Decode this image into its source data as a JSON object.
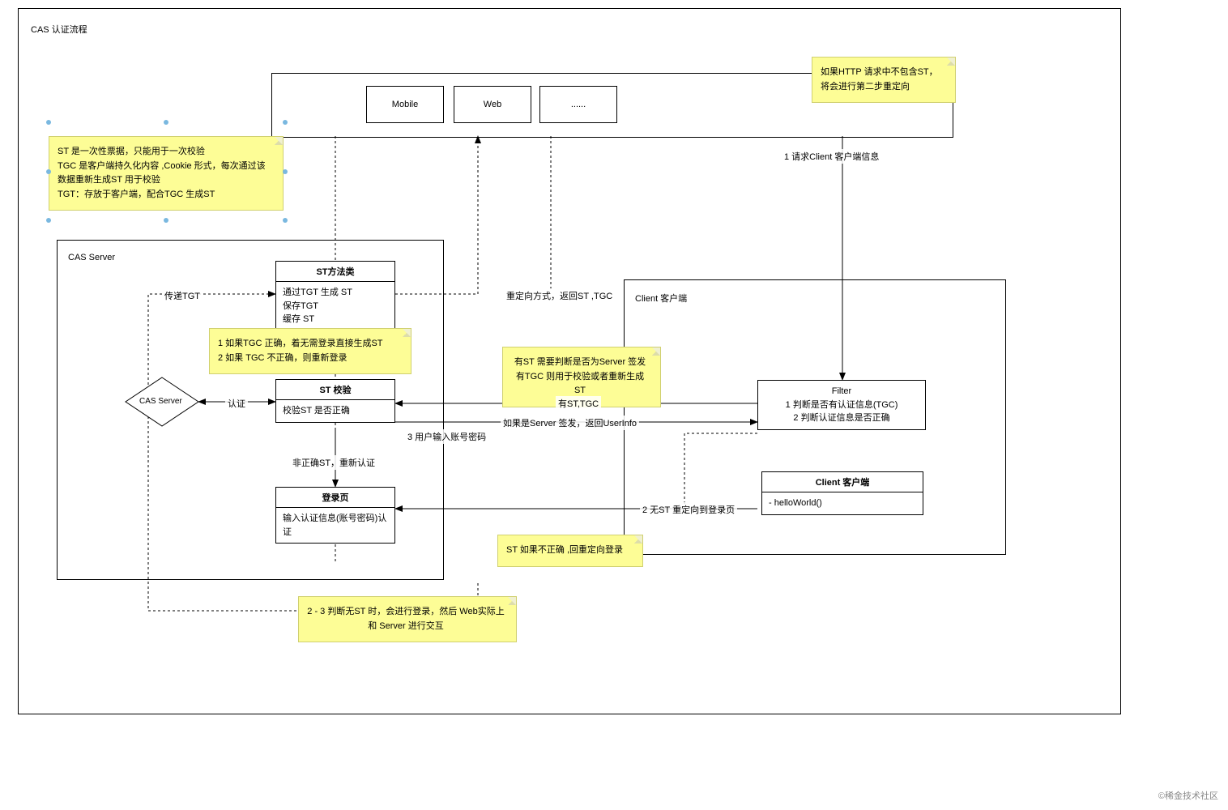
{
  "title": "CAS 认证流程",
  "top": {
    "mobile": "Mobile",
    "web": "Web",
    "more": "......"
  },
  "casServer": {
    "title": "CAS Server",
    "stMethod": {
      "title": "ST方法类",
      "l1": "通过TGT 生成 ST",
      "l2": "保存TGT",
      "l3": "缓存 ST"
    },
    "stCheck": {
      "title": "ST 校验",
      "body": "校验ST 是否正确"
    },
    "login": {
      "title": "登录页",
      "body": "输入认证信息(账号密码)认证"
    },
    "diamond": "CAS Server"
  },
  "client": {
    "title": "Client 客户端",
    "filter": {
      "title": "Filter",
      "l1": "1 判断是否有认证信息(TGC)",
      "l2": "2 判断认证信息是否正确"
    },
    "clientBox": {
      "title": "Client 客户端",
      "body": "- helloWorld()"
    }
  },
  "notes": {
    "n1": "ST  是一次性票据，只能用于一次校验\nTGC 是客户端持久化内容 ,Cookie 形式，每次通过该数据重新生成ST 用于校验\nTGT：存放于客户端，配合TGC 生成ST",
    "n2": "1 如果TGC 正确，着无需登录直接生成ST\n2 如果 TGC 不正确，则重新登录",
    "n3": "有ST 需要判断是否为Server 签发\n有TGC 则用于校验或者重新生成ST",
    "n4": "如果HTTP 请求中不包含ST，将会进行第二步重定向",
    "n5": "ST 如果不正确 ,回重定向登录",
    "n6": "2 - 3 判断无ST 时，会进行登录，然后 Web实际上和 Server 进行交互"
  },
  "edges": {
    "e1": "1 请求Client 客户端信息",
    "e2": "重定向方式，返回ST ,TGC",
    "e3": "传递TGT",
    "e4": "认证",
    "e5": "有ST,TGC",
    "e6": "如果是Server 签发，返回UserInfo",
    "e7": "3 用户输入账号密码",
    "e8": "非正确ST，重新认证",
    "e9": "2 无ST 重定向到登录页"
  },
  "watermark": "©稀金技术社区"
}
